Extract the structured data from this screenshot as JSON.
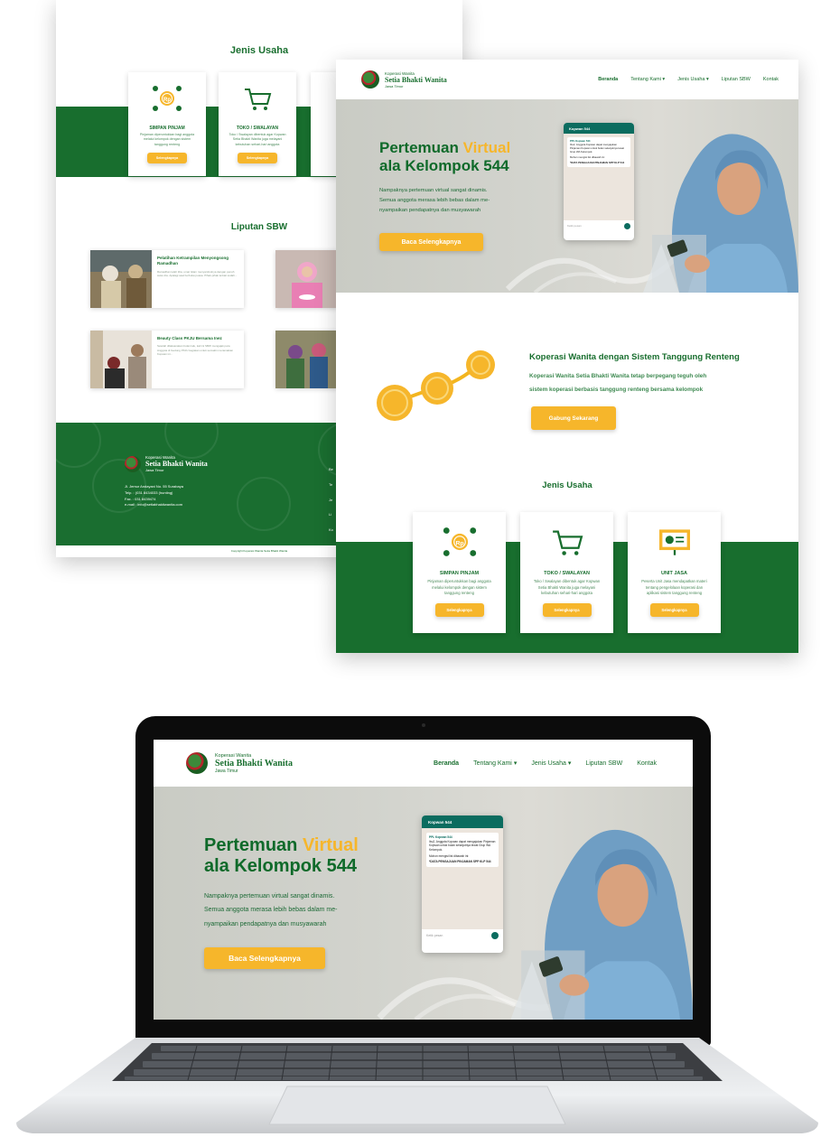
{
  "brand": {
    "l1": "Koperasi Wanita",
    "l2": "Setia Bhakti Wanita",
    "l3": "Jawa Timur"
  },
  "nav": {
    "beranda": "Beranda",
    "tentang": "Tentang Kami",
    "jenis": "Jenis Usaha",
    "liputan": "Liputan SBW",
    "kontak": "Kontak"
  },
  "hero": {
    "title_a": "Pertemuan ",
    "title_hl": "Virtual",
    "title_b": "ala Kelompok 544",
    "para_1": "Nampaknya pertemuan virtual sangat dinamis.",
    "para_2": "Semua anggota merasa lebih bebas dalam me-",
    "para_3": "nyampaikan pendapatnya dan musyawarah",
    "button": "Baca Selengkapnya"
  },
  "phone": {
    "chat_title": "Kopwan 544",
    "msg_1": "PPL Kopwan 544",
    "msg_2": "Ibu2, Anggota Kopwan dapat mengajukan Pinjaman Kopwan untuk bulan selanjutnya lewat Grup WA Kelompok.",
    "msg_3": "Mohon mengisi list dibawah ini:",
    "msg_4": "*DATA PENGAJUAN PINJAMAN SPP KLP 544",
    "input": "Ketik pesan"
  },
  "about": {
    "title": "Koperasi Wanita dengan Sistem Tanggung Renteng",
    "desc_1": "Koperasi Wanita Setia Bhakti Wanita tetap berpegang teguh oleh",
    "desc_2": "sistem koperasi berbasis tanggung renteng bersama kelompok",
    "button": "Gabung Sekarang"
  },
  "jenis_usaha": {
    "title": "Jenis Usaha",
    "cards": [
      {
        "title": "SIMPAN PINJAM",
        "d1": "Pinjaman diperuntukkan bagi anggota",
        "d2": "melalui kelompok dengan sistem",
        "d3": "tanggung renteng",
        "button": "Selengkapnya",
        "icon": "coin-people-icon"
      },
      {
        "title": "TOKO / SWALAYAN",
        "d1": "Toko / Swalayan dibentuk agar Kopwan",
        "d2": "Setia Bhakti Wanita juga melayani",
        "d3": "kebutuhan sehari-hari anggota",
        "button": "Selengkapnya",
        "icon": "shopping-cart-icon"
      },
      {
        "title": "UNIT JASA",
        "d1": "Peserta Unit Jasa mendapatkan materi",
        "d2": "tentang pengelolaan koperasi dan",
        "d3": "aplikasi sistem tanggung renteng",
        "button": "Selengkapnya",
        "icon": "presentation-board-icon"
      }
    ]
  },
  "liputan": {
    "title": "Liputan SBW",
    "posts": [
      {
        "title": "Pelatihan Ketrampilan Menyongsong Ramadhan",
        "desc": "Ramadhan telah tiba, umat Islam menyambutnya dengan penuh suka cita. Apalagi saat berbuka puasa. Pihak-pihak terkait sudah..."
      },
      {
        "title": "Beauty Class PKJU Bersama Inez",
        "desc": "Setelah dilaksanakan bulan lalu, kali ini SBW mengajak para Anggota di Gedung PKJU kegiatan untuk semakin meramaikan Kopwan ini..."
      }
    ]
  },
  "footer": {
    "address": "Jl. Jemur Andayani No. 55 Surabaya",
    "phone": "Telp. : (031 8434033 (hunting)",
    "fax": "Fax. : 031 8439474",
    "email": "e-mail : info@setiabhaktiwanita.com",
    "copyright": "Copyright Koperasi Wanita Setia Bhakti Wanita",
    "col_1": "Be",
    "col_2": "Te",
    "col_3": "Je",
    "col_4": "Li",
    "col_5": "Ko"
  },
  "colors": {
    "brand_green": "#186e2e",
    "accent_yellow": "#f6b62b",
    "footer_green": "#1a6e30",
    "laptop_bezel": "#0c0c0c"
  }
}
